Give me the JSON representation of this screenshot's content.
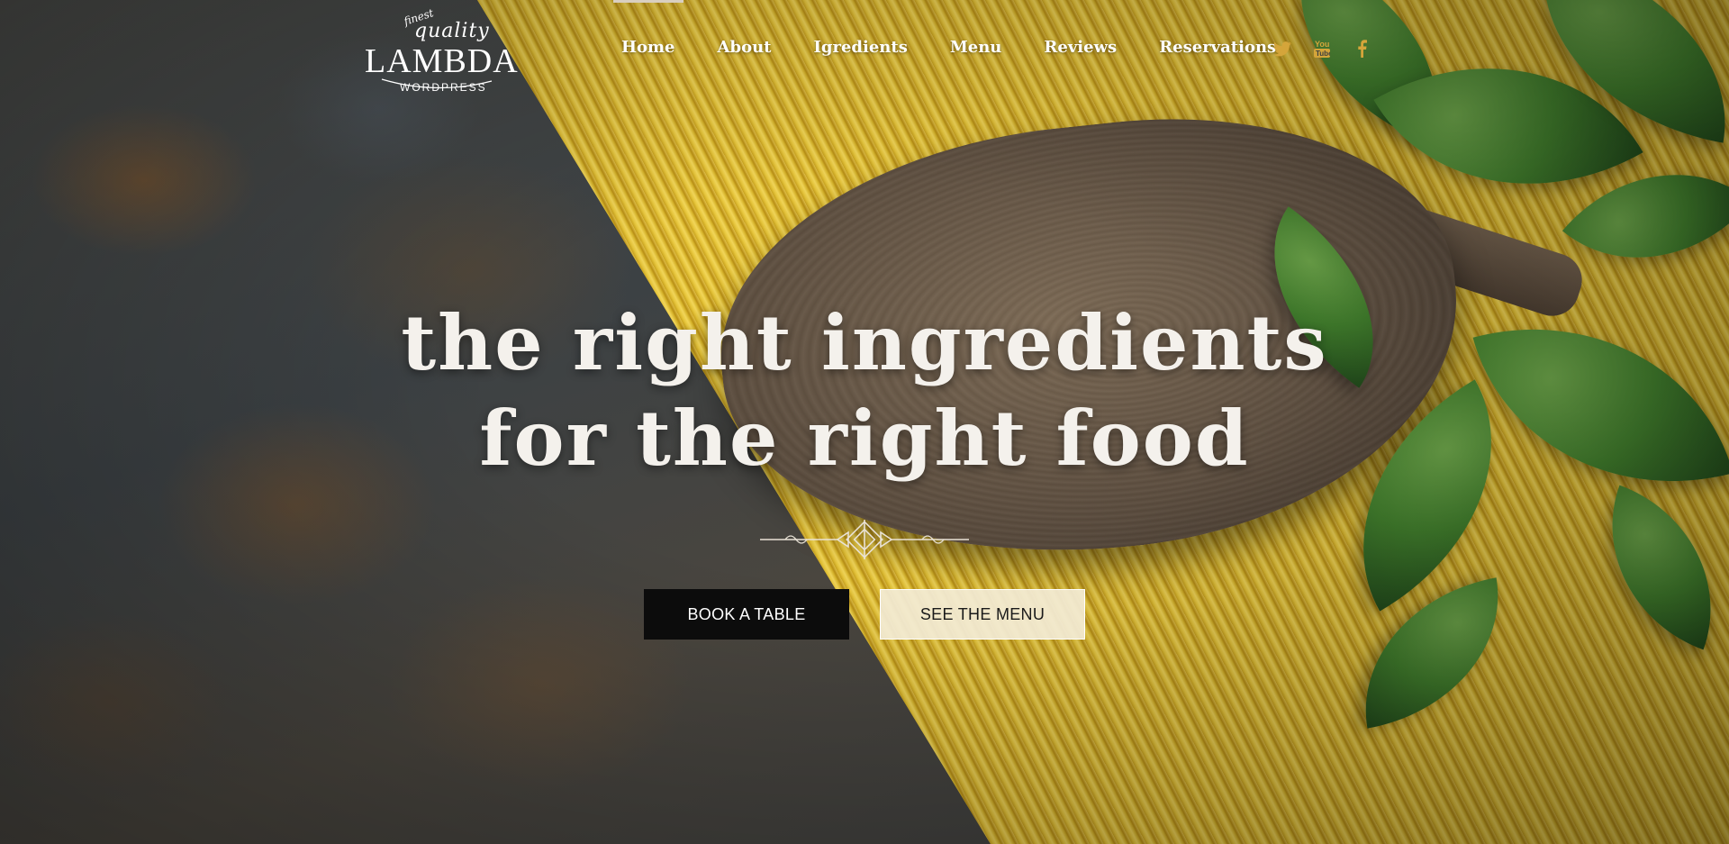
{
  "logo": {
    "top_small": "finest",
    "script": "quality",
    "name": "LAMBDA",
    "sub": "WORDPRESS"
  },
  "nav": {
    "items": [
      {
        "label": "Home",
        "active": true
      },
      {
        "label": "About"
      },
      {
        "label": "Igredients"
      },
      {
        "label": "Menu"
      },
      {
        "label": "Reviews"
      },
      {
        "label": "Reservations"
      }
    ]
  },
  "social": {
    "icons": [
      "twitter-icon",
      "youtube-icon",
      "facebook-icon"
    ],
    "accent_color": "#d4a53a"
  },
  "hero": {
    "headline_line1": "the right ingredients",
    "headline_line2": "for the right food",
    "primary_button": "BOOK A TABLE",
    "secondary_button": "SEE THE MENU"
  },
  "colors": {
    "primary_button_bg": "#0c0c0c",
    "secondary_button_bg": "#f3ecd6",
    "headline": "#f4f1ec"
  }
}
